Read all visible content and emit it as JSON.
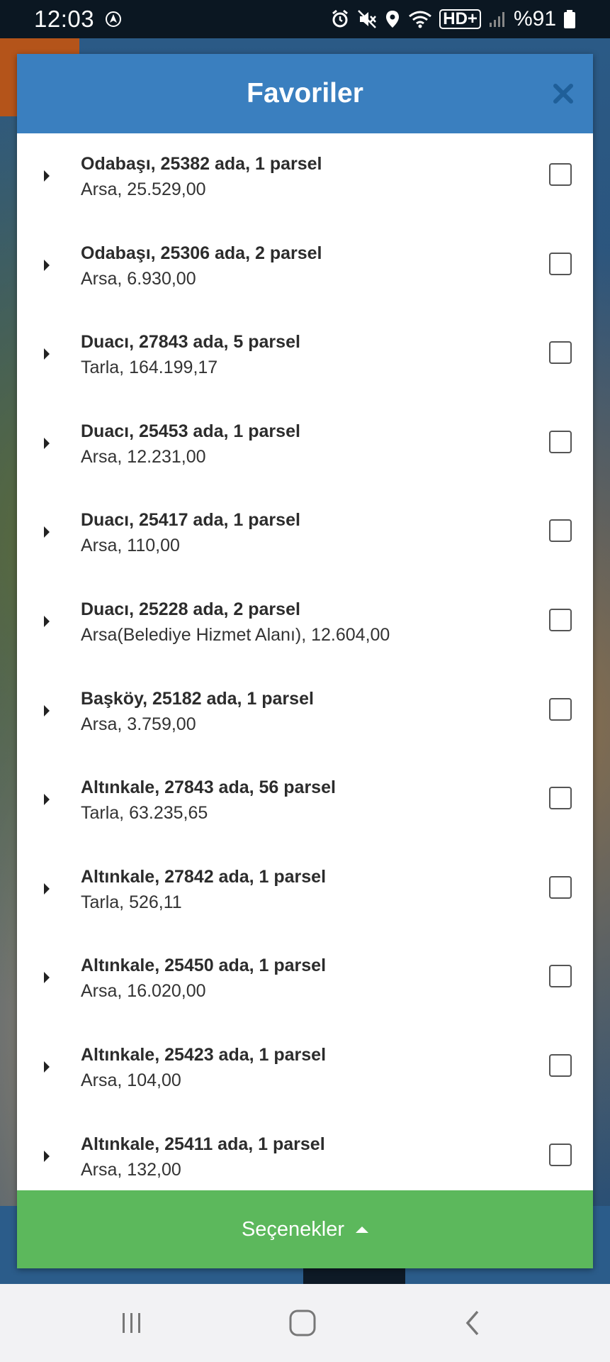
{
  "status_bar": {
    "time": "12:03",
    "network_label": "HD+",
    "battery_percent": "%91",
    "icons": [
      "navigation-icon",
      "alarm-icon",
      "mute-icon",
      "location-icon",
      "wifi-icon",
      "signal-icon",
      "battery-icon"
    ]
  },
  "dialog": {
    "title": "Favoriler",
    "close_icon": "close-icon",
    "items": [
      {
        "title": "Odabaşı, 25382 ada, 1 parsel",
        "subtitle": "Arsa, 25.529,00",
        "checked": false
      },
      {
        "title": "Odabaşı, 25306 ada, 2 parsel",
        "subtitle": "Arsa, 6.930,00",
        "checked": false
      },
      {
        "title": "Duacı, 27843 ada, 5 parsel",
        "subtitle": "Tarla, 164.199,17",
        "checked": false
      },
      {
        "title": "Duacı, 25453 ada, 1 parsel",
        "subtitle": "Arsa, 12.231,00",
        "checked": false
      },
      {
        "title": "Duacı, 25417 ada, 1 parsel",
        "subtitle": "Arsa, 110,00",
        "checked": false
      },
      {
        "title": "Duacı, 25228 ada, 2 parsel",
        "subtitle": "Arsa(Belediye Hizmet Alanı), 12.604,00",
        "checked": false
      },
      {
        "title": "Başköy, 25182 ada, 1 parsel",
        "subtitle": "Arsa, 3.759,00",
        "checked": false
      },
      {
        "title": "Altınkale, 27843 ada, 56 parsel",
        "subtitle": "Tarla, 63.235,65",
        "checked": false
      },
      {
        "title": "Altınkale, 27842 ada, 1 parsel",
        "subtitle": "Tarla, 526,11",
        "checked": false
      },
      {
        "title": "Altınkale, 25450 ada, 1 parsel",
        "subtitle": "Arsa, 16.020,00",
        "checked": false
      },
      {
        "title": "Altınkale, 25423 ada, 1 parsel",
        "subtitle": "Arsa, 104,00",
        "checked": false
      },
      {
        "title": "Altınkale, 25411 ada, 1 parsel",
        "subtitle": "Arsa, 132,00",
        "checked": false
      }
    ],
    "footer_label": "Seçenekler"
  },
  "nav_bar": {
    "buttons": [
      "recent-apps-icon",
      "home-icon",
      "back-icon"
    ]
  },
  "colors": {
    "header": "#3a7fbf",
    "footer": "#5cb85c"
  }
}
